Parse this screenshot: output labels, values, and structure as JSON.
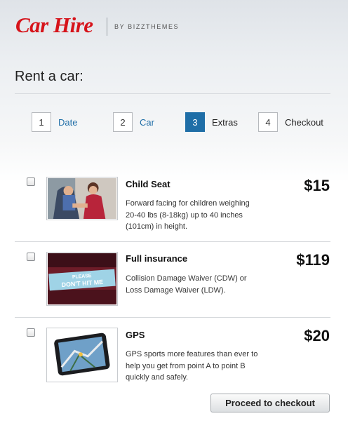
{
  "header": {
    "logo_text": "Car Hire",
    "byline": "BY BIZZTHEMES",
    "brand_color": "#d6131a"
  },
  "page": {
    "title": "Rent a car:"
  },
  "steps": [
    {
      "number": "1",
      "label": "Date",
      "state": "link"
    },
    {
      "number": "2",
      "label": "Car",
      "state": "link"
    },
    {
      "number": "3",
      "label": "Extras",
      "state": "active"
    },
    {
      "number": "4",
      "label": "Checkout",
      "state": "upcoming"
    }
  ],
  "extras": [
    {
      "name": "Child Seat",
      "description": "Forward facing for children weighing 20-40 lbs (8-18kg) up to 40 inches (101cm) in height.",
      "price": "$15",
      "checked": false
    },
    {
      "name": "Full insurance",
      "description": "Collision Damage Waiver (CDW) or Loss Damage Waiver (LDW).",
      "price": "$119",
      "checked": false,
      "image_text": "PLEASE DON'T HIT ME"
    },
    {
      "name": "GPS",
      "description": "GPS sports more features than ever to help you get from point A to point B quickly and safely.",
      "price": "$20",
      "checked": false
    }
  ],
  "actions": {
    "checkout_label": "Proceed to checkout"
  },
  "colors": {
    "accent": "#1f6ea7",
    "brand": "#d6131a"
  }
}
